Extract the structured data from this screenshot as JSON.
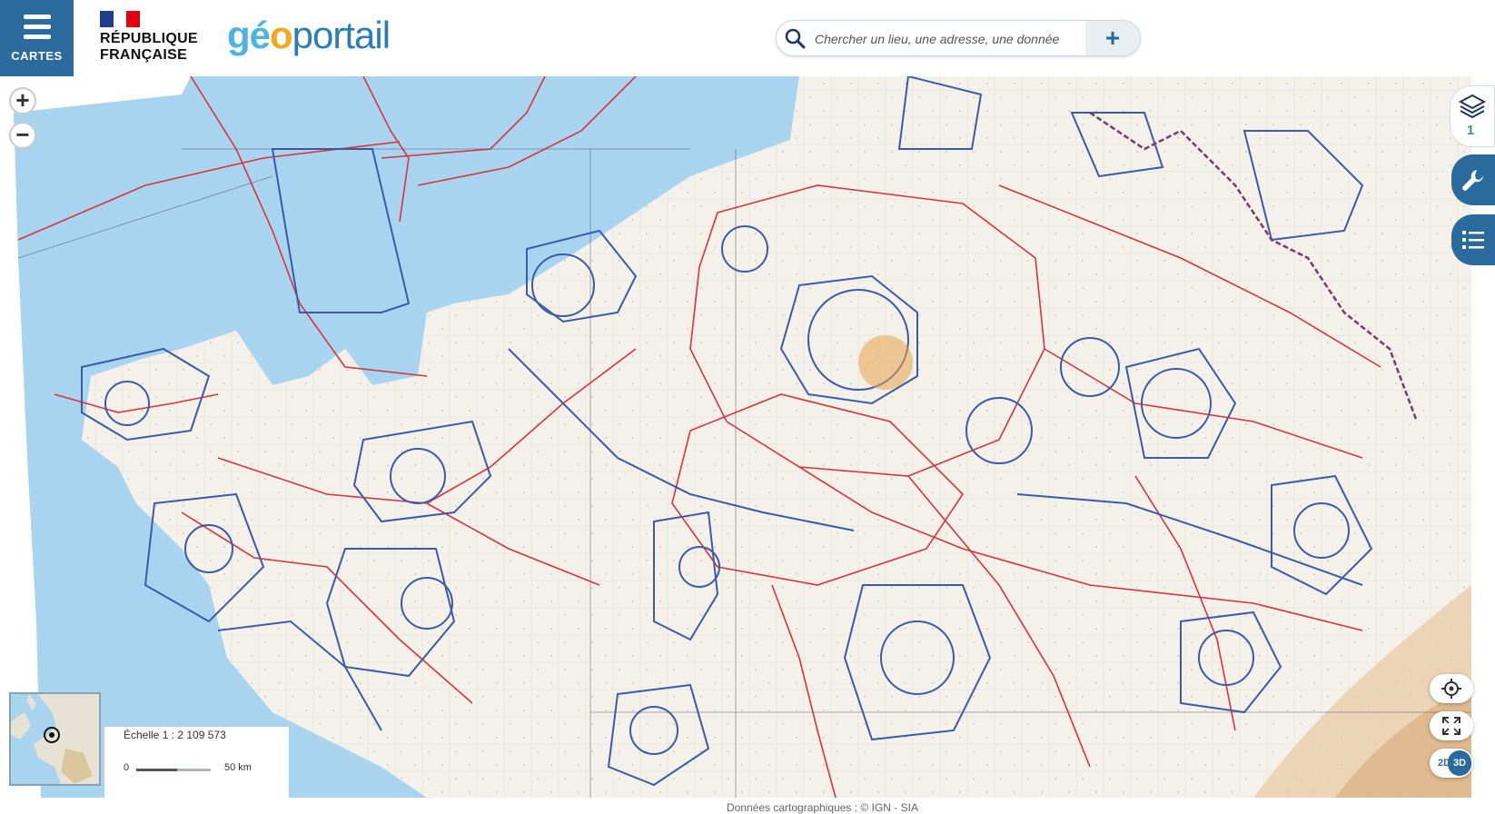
{
  "header": {
    "menu_label": "CARTES",
    "republic_line1": "RÉPUBLIQUE",
    "republic_line2": "FRANÇAISE",
    "logo_geo": "gé",
    "logo_o": "o",
    "logo_portail": "portail"
  },
  "search": {
    "placeholder": "Chercher un lieu, une adresse, une donnée",
    "add_label": "+"
  },
  "zoom": {
    "in_label": "+",
    "out_label": "−"
  },
  "layers": {
    "count": "1"
  },
  "view_mode": {
    "label_2d": "2D",
    "label_3d": "3D",
    "active": "3D"
  },
  "scale": {
    "label": "Échelle 1 : 2 109 573",
    "start": "0",
    "end": "50 km"
  },
  "attribution": "Données cartographiques : © IGN - SIA",
  "colors": {
    "brand_blue": "#2a6a9c",
    "sea": "#a8d4ef",
    "land": "#f3f1ea",
    "airspace_red": "#d8343c",
    "airspace_blue": "#3c5aa8"
  },
  "icons": [
    "search-icon",
    "plus-icon",
    "layers-icon",
    "wrench-icon",
    "legend-list-icon",
    "locate-icon",
    "fullscreen-icon"
  ]
}
